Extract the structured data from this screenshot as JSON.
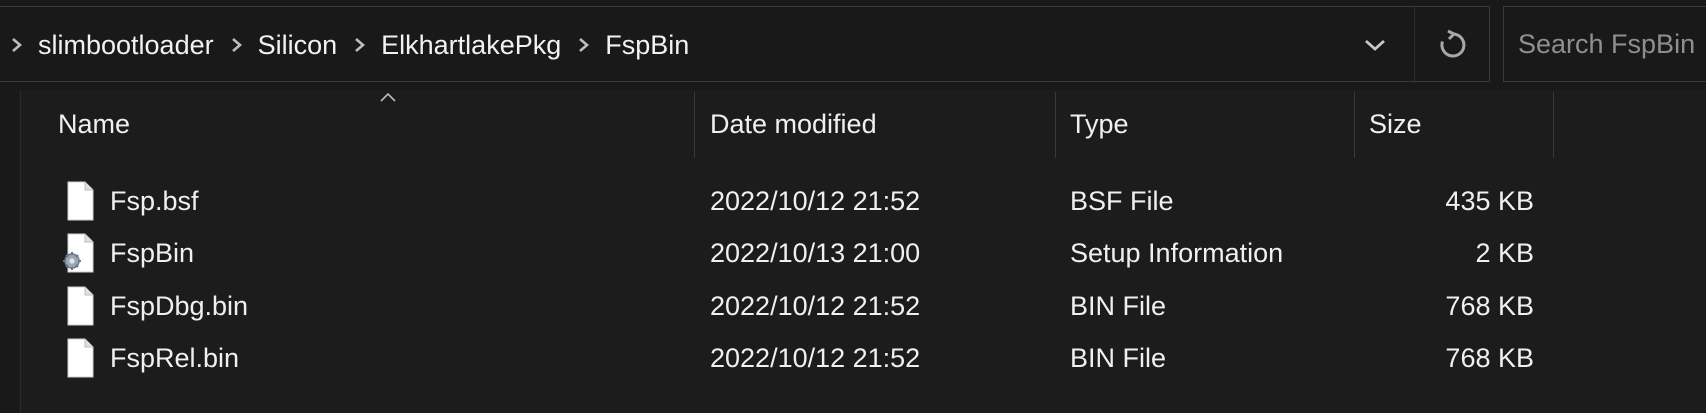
{
  "breadcrumb": {
    "items": [
      "slimbootloader",
      "Silicon",
      "ElkhartlakePkg",
      "FspBin"
    ]
  },
  "search": {
    "placeholder": "Search FspBin"
  },
  "columns": {
    "name": "Name",
    "date": "Date modified",
    "type": "Type",
    "size": "Size"
  },
  "files": [
    {
      "name": "Fsp.bsf",
      "date": "2022/10/12 21:52",
      "type": "BSF File",
      "size": "435 KB",
      "icon": "document-icon"
    },
    {
      "name": "FspBin",
      "date": "2022/10/13 21:00",
      "type": "Setup Information",
      "size": "2 KB",
      "icon": "setup-information-icon"
    },
    {
      "name": "FspDbg.bin",
      "date": "2022/10/12 21:52",
      "type": "BIN File",
      "size": "768 KB",
      "icon": "document-icon"
    },
    {
      "name": "FspRel.bin",
      "date": "2022/10/12 21:52",
      "type": "BIN File",
      "size": "768 KB",
      "icon": "document-icon"
    }
  ],
  "colors": {
    "background": "#191919",
    "text": "#f0f0f0",
    "placeholder": "#8f8f8f",
    "border": "#3a3a3a"
  }
}
